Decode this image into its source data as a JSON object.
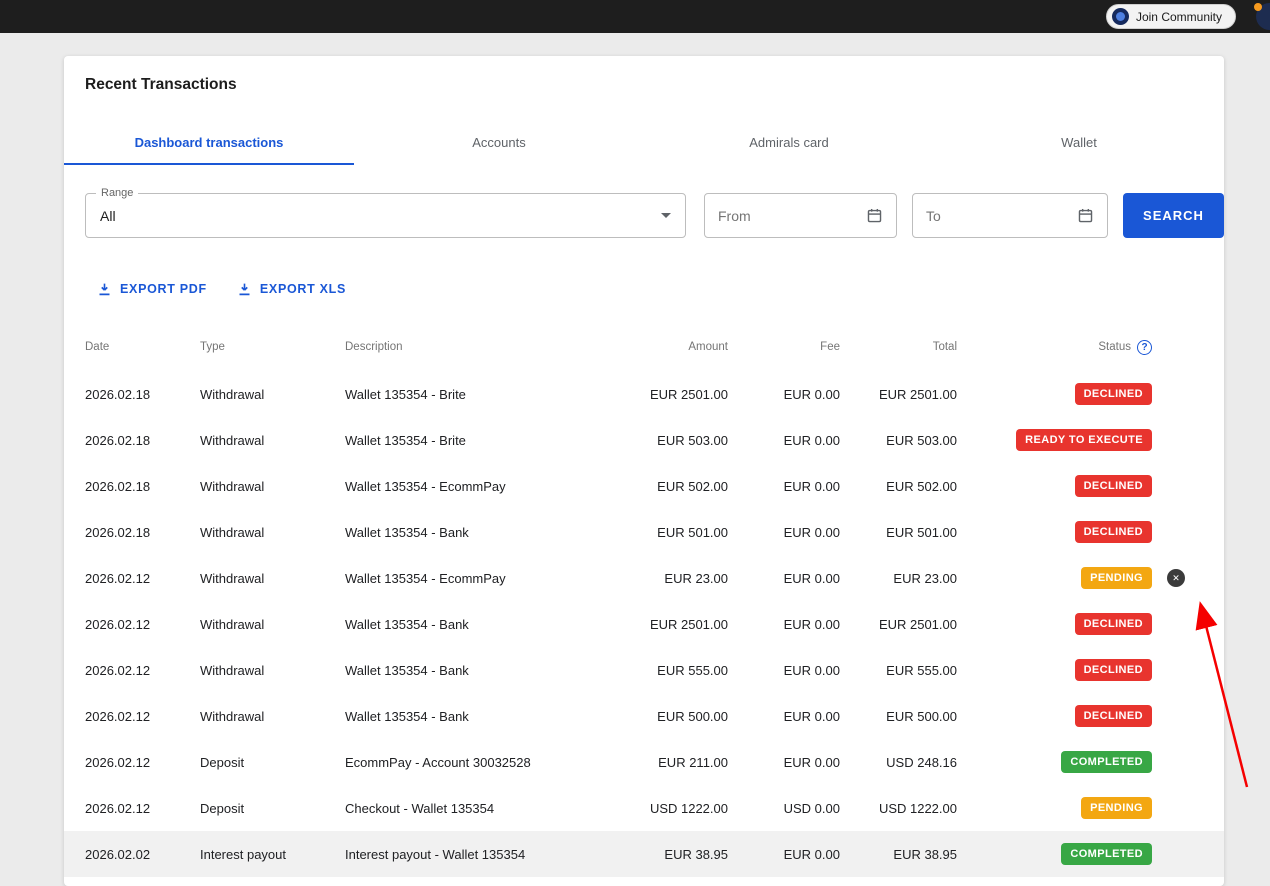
{
  "colors": {
    "accent": "#1a57d6",
    "red": "#e8342e",
    "amber": "#f3a712",
    "green": "#38a745",
    "annotation": "#f50000",
    "topbar_bg": "#1e1e1e",
    "page_bg": "#ebebeb"
  },
  "topbar": {
    "join_community_label": "Join Community"
  },
  "panel": {
    "title": "Recent Transactions",
    "tabs": [
      {
        "label": "Dashboard transactions",
        "active": true
      },
      {
        "label": "Accounts",
        "active": false
      },
      {
        "label": "Admirals card",
        "active": false
      },
      {
        "label": "Wallet",
        "active": false
      }
    ],
    "filters": {
      "range_label": "Range",
      "range_value": "All",
      "from_placeholder": "From",
      "to_placeholder": "To",
      "search_label": "SEARCH"
    },
    "exports": {
      "pdf_label": "EXPORT PDF",
      "xls_label": "EXPORT XLS"
    },
    "table": {
      "headers": {
        "date": "Date",
        "type": "Type",
        "description": "Description",
        "amount": "Amount",
        "fee": "Fee",
        "total": "Total",
        "status": "Status"
      },
      "rows": [
        {
          "date": "2026.02.18",
          "type": "Withdrawal",
          "description": "Wallet 135354 - Brite",
          "amount": "EUR 2501.00",
          "fee": "EUR 0.00",
          "total": "EUR 2501.00",
          "status": "DECLINED",
          "status_color": "red"
        },
        {
          "date": "2026.02.18",
          "type": "Withdrawal",
          "description": "Wallet 135354 - Brite",
          "amount": "EUR 503.00",
          "fee": "EUR 0.00",
          "total": "EUR 503.00",
          "status": "READY TO EXECUTE",
          "status_color": "red"
        },
        {
          "date": "2026.02.18",
          "type": "Withdrawal",
          "description": "Wallet 135354 - EcommPay",
          "amount": "EUR 502.00",
          "fee": "EUR 0.00",
          "total": "EUR 502.00",
          "status": "DECLINED",
          "status_color": "red"
        },
        {
          "date": "2026.02.18",
          "type": "Withdrawal",
          "description": "Wallet 135354 - Bank",
          "amount": "EUR 501.00",
          "fee": "EUR 0.00",
          "total": "EUR 501.00",
          "status": "DECLINED",
          "status_color": "red"
        },
        {
          "date": "2026.02.12",
          "type": "Withdrawal",
          "description": "Wallet 135354 - EcommPay",
          "amount": "EUR 23.00",
          "fee": "EUR 0.00",
          "total": "EUR 23.00",
          "status": "PENDING",
          "status_color": "amber",
          "cancellable": true
        },
        {
          "date": "2026.02.12",
          "type": "Withdrawal",
          "description": "Wallet 135354 - Bank",
          "amount": "EUR 2501.00",
          "fee": "EUR 0.00",
          "total": "EUR 2501.00",
          "status": "DECLINED",
          "status_color": "red"
        },
        {
          "date": "2026.02.12",
          "type": "Withdrawal",
          "description": "Wallet 135354 - Bank",
          "amount": "EUR 555.00",
          "fee": "EUR 0.00",
          "total": "EUR 555.00",
          "status": "DECLINED",
          "status_color": "red"
        },
        {
          "date": "2026.02.12",
          "type": "Withdrawal",
          "description": "Wallet 135354 - Bank",
          "amount": "EUR 500.00",
          "fee": "EUR 0.00",
          "total": "EUR 500.00",
          "status": "DECLINED",
          "status_color": "red"
        },
        {
          "date": "2026.02.12",
          "type": "Deposit",
          "description": "EcommPay - Account 30032528",
          "amount": "EUR 211.00",
          "fee": "EUR 0.00",
          "total": "USD 248.16",
          "status": "COMPLETED",
          "status_color": "green"
        },
        {
          "date": "2026.02.12",
          "type": "Deposit",
          "description": "Checkout - Wallet 135354",
          "amount": "USD 1222.00",
          "fee": "USD 0.00",
          "total": "USD 1222.00",
          "status": "PENDING",
          "status_color": "amber"
        },
        {
          "date": "2026.02.02",
          "type": "Interest payout",
          "description": "Interest payout - Wallet 135354",
          "amount": "EUR 38.95",
          "fee": "EUR 0.00",
          "total": "EUR 38.95",
          "status": "COMPLETED",
          "status_color": "green",
          "highlighted": true
        }
      ]
    }
  }
}
